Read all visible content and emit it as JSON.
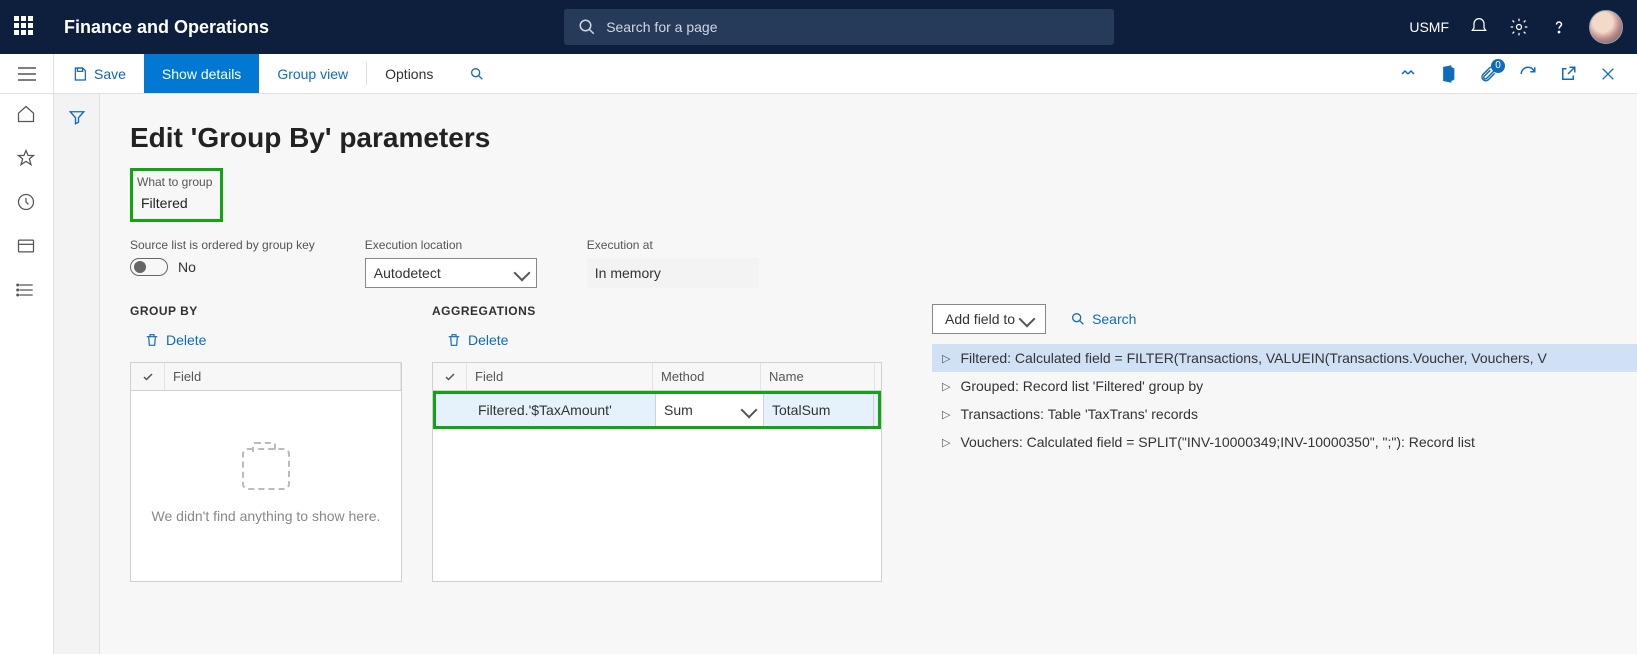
{
  "header": {
    "brand": "Finance and Operations",
    "search_placeholder": "Search for a page",
    "legal_entity": "USMF"
  },
  "cmdbar": {
    "save": "Save",
    "show_details": "Show details",
    "group_view": "Group view",
    "options": "Options",
    "badge": "0"
  },
  "page": {
    "title": "Edit 'Group By' parameters",
    "what_to_group_label": "What to group",
    "what_to_group_value": "Filtered",
    "ordered_label": "Source list is ordered by group key",
    "ordered_value": "No",
    "exec_loc_label": "Execution location",
    "exec_loc_value": "Autodetect",
    "exec_at_label": "Execution at",
    "exec_at_value": "In memory"
  },
  "groupby": {
    "title": "Group by",
    "delete": "Delete",
    "col_field": "Field",
    "empty": "We didn't find anything to show here."
  },
  "agg": {
    "title": "Aggregations",
    "delete": "Delete",
    "col_field": "Field",
    "col_method": "Method",
    "col_name": "Name",
    "rows": [
      {
        "field": "Filtered.'$TaxAmount'",
        "method": "Sum",
        "name": "TotalSum"
      }
    ]
  },
  "ds": {
    "add_btn": "Add field to",
    "search": "Search",
    "items": [
      "Filtered: Calculated field = FILTER(Transactions, VALUEIN(Transactions.Voucher, Vouchers, V",
      "Grouped: Record list 'Filtered' group by",
      "Transactions: Table 'TaxTrans' records",
      "Vouchers: Calculated field = SPLIT(\"INV-10000349;INV-10000350\", \";\"): Record list"
    ]
  }
}
